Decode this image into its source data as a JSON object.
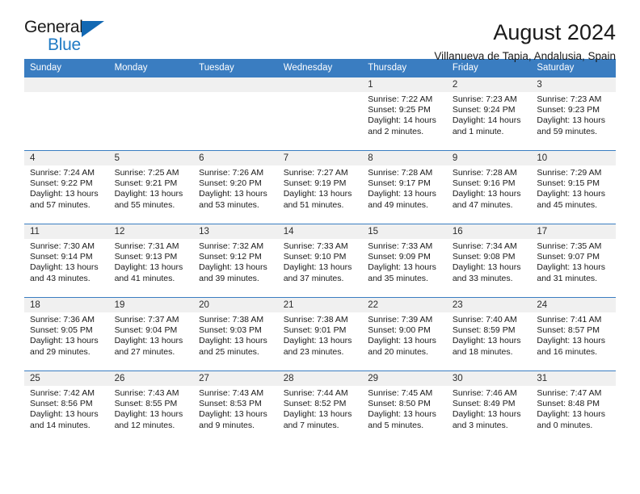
{
  "logo": {
    "text_top": "General",
    "text_bottom": "Blue",
    "triangle_color": "#1268b3",
    "blue_color": "#1f7ac4"
  },
  "header": {
    "title": "August 2024",
    "subtitle": "Villanueva de Tapia, Andalusia, Spain"
  },
  "theme": {
    "header_blue": "#3a7dc1",
    "daynum_band": "#f0f0f0"
  },
  "weekday_headers": [
    "Sunday",
    "Monday",
    "Tuesday",
    "Wednesday",
    "Thursday",
    "Friday",
    "Saturday"
  ],
  "weeks": [
    [
      {
        "day": "",
        "sunrise": "",
        "sunset": "",
        "daylight1": "",
        "daylight2": ""
      },
      {
        "day": "",
        "sunrise": "",
        "sunset": "",
        "daylight1": "",
        "daylight2": ""
      },
      {
        "day": "",
        "sunrise": "",
        "sunset": "",
        "daylight1": "",
        "daylight2": ""
      },
      {
        "day": "",
        "sunrise": "",
        "sunset": "",
        "daylight1": "",
        "daylight2": ""
      },
      {
        "day": "1",
        "sunrise": "Sunrise: 7:22 AM",
        "sunset": "Sunset: 9:25 PM",
        "daylight1": "Daylight: 14 hours",
        "daylight2": "and 2 minutes."
      },
      {
        "day": "2",
        "sunrise": "Sunrise: 7:23 AM",
        "sunset": "Sunset: 9:24 PM",
        "daylight1": "Daylight: 14 hours",
        "daylight2": "and 1 minute."
      },
      {
        "day": "3",
        "sunrise": "Sunrise: 7:23 AM",
        "sunset": "Sunset: 9:23 PM",
        "daylight1": "Daylight: 13 hours",
        "daylight2": "and 59 minutes."
      }
    ],
    [
      {
        "day": "4",
        "sunrise": "Sunrise: 7:24 AM",
        "sunset": "Sunset: 9:22 PM",
        "daylight1": "Daylight: 13 hours",
        "daylight2": "and 57 minutes."
      },
      {
        "day": "5",
        "sunrise": "Sunrise: 7:25 AM",
        "sunset": "Sunset: 9:21 PM",
        "daylight1": "Daylight: 13 hours",
        "daylight2": "and 55 minutes."
      },
      {
        "day": "6",
        "sunrise": "Sunrise: 7:26 AM",
        "sunset": "Sunset: 9:20 PM",
        "daylight1": "Daylight: 13 hours",
        "daylight2": "and 53 minutes."
      },
      {
        "day": "7",
        "sunrise": "Sunrise: 7:27 AM",
        "sunset": "Sunset: 9:19 PM",
        "daylight1": "Daylight: 13 hours",
        "daylight2": "and 51 minutes."
      },
      {
        "day": "8",
        "sunrise": "Sunrise: 7:28 AM",
        "sunset": "Sunset: 9:17 PM",
        "daylight1": "Daylight: 13 hours",
        "daylight2": "and 49 minutes."
      },
      {
        "day": "9",
        "sunrise": "Sunrise: 7:28 AM",
        "sunset": "Sunset: 9:16 PM",
        "daylight1": "Daylight: 13 hours",
        "daylight2": "and 47 minutes."
      },
      {
        "day": "10",
        "sunrise": "Sunrise: 7:29 AM",
        "sunset": "Sunset: 9:15 PM",
        "daylight1": "Daylight: 13 hours",
        "daylight2": "and 45 minutes."
      }
    ],
    [
      {
        "day": "11",
        "sunrise": "Sunrise: 7:30 AM",
        "sunset": "Sunset: 9:14 PM",
        "daylight1": "Daylight: 13 hours",
        "daylight2": "and 43 minutes."
      },
      {
        "day": "12",
        "sunrise": "Sunrise: 7:31 AM",
        "sunset": "Sunset: 9:13 PM",
        "daylight1": "Daylight: 13 hours",
        "daylight2": "and 41 minutes."
      },
      {
        "day": "13",
        "sunrise": "Sunrise: 7:32 AM",
        "sunset": "Sunset: 9:12 PM",
        "daylight1": "Daylight: 13 hours",
        "daylight2": "and 39 minutes."
      },
      {
        "day": "14",
        "sunrise": "Sunrise: 7:33 AM",
        "sunset": "Sunset: 9:10 PM",
        "daylight1": "Daylight: 13 hours",
        "daylight2": "and 37 minutes."
      },
      {
        "day": "15",
        "sunrise": "Sunrise: 7:33 AM",
        "sunset": "Sunset: 9:09 PM",
        "daylight1": "Daylight: 13 hours",
        "daylight2": "and 35 minutes."
      },
      {
        "day": "16",
        "sunrise": "Sunrise: 7:34 AM",
        "sunset": "Sunset: 9:08 PM",
        "daylight1": "Daylight: 13 hours",
        "daylight2": "and 33 minutes."
      },
      {
        "day": "17",
        "sunrise": "Sunrise: 7:35 AM",
        "sunset": "Sunset: 9:07 PM",
        "daylight1": "Daylight: 13 hours",
        "daylight2": "and 31 minutes."
      }
    ],
    [
      {
        "day": "18",
        "sunrise": "Sunrise: 7:36 AM",
        "sunset": "Sunset: 9:05 PM",
        "daylight1": "Daylight: 13 hours",
        "daylight2": "and 29 minutes."
      },
      {
        "day": "19",
        "sunrise": "Sunrise: 7:37 AM",
        "sunset": "Sunset: 9:04 PM",
        "daylight1": "Daylight: 13 hours",
        "daylight2": "and 27 minutes."
      },
      {
        "day": "20",
        "sunrise": "Sunrise: 7:38 AM",
        "sunset": "Sunset: 9:03 PM",
        "daylight1": "Daylight: 13 hours",
        "daylight2": "and 25 minutes."
      },
      {
        "day": "21",
        "sunrise": "Sunrise: 7:38 AM",
        "sunset": "Sunset: 9:01 PM",
        "daylight1": "Daylight: 13 hours",
        "daylight2": "and 23 minutes."
      },
      {
        "day": "22",
        "sunrise": "Sunrise: 7:39 AM",
        "sunset": "Sunset: 9:00 PM",
        "daylight1": "Daylight: 13 hours",
        "daylight2": "and 20 minutes."
      },
      {
        "day": "23",
        "sunrise": "Sunrise: 7:40 AM",
        "sunset": "Sunset: 8:59 PM",
        "daylight1": "Daylight: 13 hours",
        "daylight2": "and 18 minutes."
      },
      {
        "day": "24",
        "sunrise": "Sunrise: 7:41 AM",
        "sunset": "Sunset: 8:57 PM",
        "daylight1": "Daylight: 13 hours",
        "daylight2": "and 16 minutes."
      }
    ],
    [
      {
        "day": "25",
        "sunrise": "Sunrise: 7:42 AM",
        "sunset": "Sunset: 8:56 PM",
        "daylight1": "Daylight: 13 hours",
        "daylight2": "and 14 minutes."
      },
      {
        "day": "26",
        "sunrise": "Sunrise: 7:43 AM",
        "sunset": "Sunset: 8:55 PM",
        "daylight1": "Daylight: 13 hours",
        "daylight2": "and 12 minutes."
      },
      {
        "day": "27",
        "sunrise": "Sunrise: 7:43 AM",
        "sunset": "Sunset: 8:53 PM",
        "daylight1": "Daylight: 13 hours",
        "daylight2": "and 9 minutes."
      },
      {
        "day": "28",
        "sunrise": "Sunrise: 7:44 AM",
        "sunset": "Sunset: 8:52 PM",
        "daylight1": "Daylight: 13 hours",
        "daylight2": "and 7 minutes."
      },
      {
        "day": "29",
        "sunrise": "Sunrise: 7:45 AM",
        "sunset": "Sunset: 8:50 PM",
        "daylight1": "Daylight: 13 hours",
        "daylight2": "and 5 minutes."
      },
      {
        "day": "30",
        "sunrise": "Sunrise: 7:46 AM",
        "sunset": "Sunset: 8:49 PM",
        "daylight1": "Daylight: 13 hours",
        "daylight2": "and 3 minutes."
      },
      {
        "day": "31",
        "sunrise": "Sunrise: 7:47 AM",
        "sunset": "Sunset: 8:48 PM",
        "daylight1": "Daylight: 13 hours",
        "daylight2": "and 0 minutes."
      }
    ]
  ]
}
